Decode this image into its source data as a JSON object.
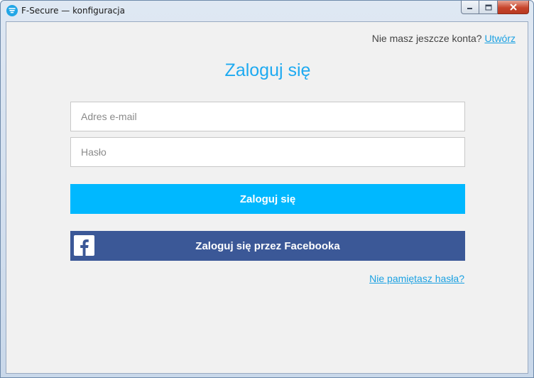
{
  "window": {
    "title": "F-Secure — konfiguracja"
  },
  "header": {
    "no_account_text": "Nie masz jeszcze konta?",
    "create_link": "Utwórz"
  },
  "login": {
    "heading": "Zaloguj się",
    "email_placeholder": "Adres e-mail",
    "password_placeholder": "Hasło",
    "login_button": "Zaloguj się",
    "facebook_button": "Zaloguj się przez Facebooka",
    "forgot_link": "Nie pamiętasz hasła?"
  },
  "colors": {
    "accent": "#00b8ff",
    "heading": "#1eaaf1",
    "facebook": "#3b5897",
    "link": "#1ba1e2"
  },
  "icons": {
    "app": "f-secure-logo-icon",
    "facebook": "facebook-icon"
  }
}
